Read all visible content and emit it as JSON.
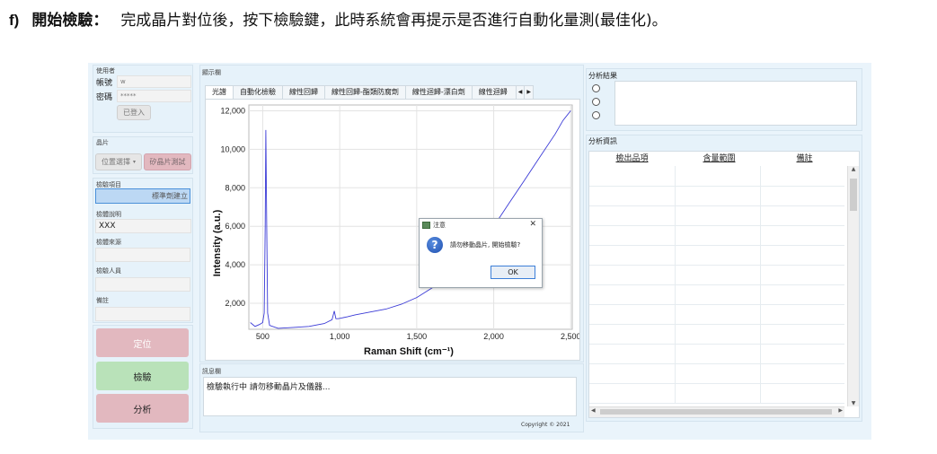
{
  "instruction": {
    "step": "f)",
    "title": "開始檢驗：",
    "text": "完成晶片對位後，按下檢驗鍵，此時系統會再提示是否進行自動化量測(最佳化)。"
  },
  "user_section": {
    "heading": "使用者",
    "account_label": "帳號",
    "account_value": "w",
    "password_label": "密碼",
    "password_value": "*****",
    "logged_in_button": "已登入"
  },
  "chip_section": {
    "heading": "晶片",
    "position_select": "位置選擇",
    "silicon_test_button": "矽晶片測試"
  },
  "inspection_section": {
    "item_label": "檢驗項目",
    "item_value": "標準劑建立",
    "sample_desc_label": "檢體說明",
    "sample_desc_value": "XXX",
    "sample_source_label": "檢體來源",
    "sample_source_value": "",
    "inspector_label": "檢驗人員",
    "inspector_value": "",
    "remarks_label": "備註",
    "remarks_value": ""
  },
  "actions": {
    "locate": "定位",
    "inspect": "檢驗",
    "analyze": "分析"
  },
  "display_section": {
    "heading": "顯示欄",
    "tabs": [
      "光譜",
      "自動化檢驗",
      "線性回歸",
      "線性回歸-酯類防腐劑",
      "線性迴歸-漂白劑",
      "線性迴歸"
    ]
  },
  "chart_data": {
    "type": "line",
    "xlabel": "Raman Shift (cm⁻¹)",
    "ylabel": "Intensity (a.u.)",
    "xlim": [
      410,
      2510
    ],
    "ylim": [
      650,
      12300
    ],
    "x_ticks": [
      500,
      1000,
      1500,
      2000,
      2500
    ],
    "x_tick_labels": [
      "500",
      "1,000",
      "1,500",
      "2,000",
      "2,500"
    ],
    "y_ticks": [
      2000,
      4000,
      6000,
      8000,
      10000,
      12000
    ],
    "y_tick_labels": [
      "2,000",
      "4,000",
      "6,000",
      "8,000",
      "10,000",
      "12,000"
    ],
    "grid": true,
    "series": [
      {
        "color": "#3a3ad6",
        "x": [
          420,
          450,
          480,
          500,
          510,
          516,
          520,
          526,
          532,
          545,
          600,
          700,
          800,
          900,
          950,
          965,
          975,
          990,
          1050,
          1100,
          1200,
          1300,
          1400,
          1500,
          1600,
          1700,
          1800,
          1900,
          2000,
          2100,
          2200,
          2300,
          2400,
          2450,
          2500
        ],
        "y": [
          1000,
          800,
          900,
          1000,
          1500,
          6000,
          11000,
          6000,
          1500,
          850,
          700,
          750,
          800,
          950,
          1150,
          1600,
          1200,
          1200,
          1300,
          1400,
          1550,
          1700,
          1950,
          2300,
          2800,
          3300,
          4000,
          4900,
          6000,
          7200,
          8400,
          9600,
          10800,
          11500,
          12000
        ]
      }
    ]
  },
  "dialog": {
    "title": "注意",
    "message": "請勿移動晶片, 開始檢驗?",
    "ok": "OK",
    "close_glyph": "✕"
  },
  "message_section": {
    "heading": "訊息欄",
    "text": "檢驗執行中 請勿移動晶片及儀器..."
  },
  "copyright": "Copyright © 2021",
  "analysis_result": {
    "heading": "分析結果"
  },
  "analysis_info": {
    "heading": "分析資訊",
    "columns": [
      "檢出品項",
      "含量範圍",
      "備註"
    ]
  },
  "colors": {
    "accent_blue": "#3a3ad6",
    "inspect_green": "#b9e2b9",
    "action_pink": "#e2b8bf"
  }
}
